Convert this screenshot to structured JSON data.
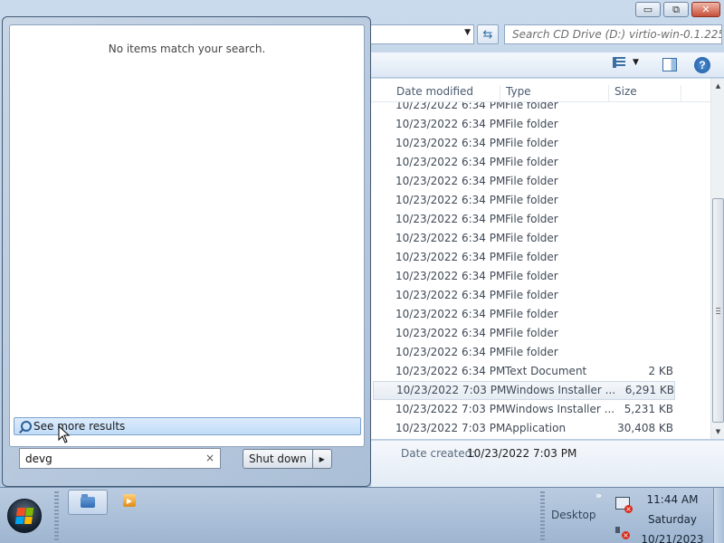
{
  "explorer": {
    "window_controls": {
      "minimize": "▭",
      "restore": "⧉",
      "close": "✕"
    },
    "address_dropdown": "▼",
    "refresh_glyph": "⇆",
    "search_placeholder": "Search CD Drive (D:) virtio-win-0.1.225",
    "toolbar": {
      "views_arrow": "▼",
      "help": "?"
    },
    "columns": {
      "date": "Date modified",
      "type": "Type",
      "size": "Size"
    },
    "rows": [
      {
        "date": "10/23/2022 6:34 PM",
        "type": "File folder",
        "size": ""
      },
      {
        "date": "10/23/2022 6:34 PM",
        "type": "File folder",
        "size": ""
      },
      {
        "date": "10/23/2022 6:34 PM",
        "type": "File folder",
        "size": ""
      },
      {
        "date": "10/23/2022 6:34 PM",
        "type": "File folder",
        "size": ""
      },
      {
        "date": "10/23/2022 6:34 PM",
        "type": "File folder",
        "size": ""
      },
      {
        "date": "10/23/2022 6:34 PM",
        "type": "File folder",
        "size": ""
      },
      {
        "date": "10/23/2022 6:34 PM",
        "type": "File folder",
        "size": ""
      },
      {
        "date": "10/23/2022 6:34 PM",
        "type": "File folder",
        "size": ""
      },
      {
        "date": "10/23/2022 6:34 PM",
        "type": "File folder",
        "size": ""
      },
      {
        "date": "10/23/2022 6:34 PM",
        "type": "File folder",
        "size": ""
      },
      {
        "date": "10/23/2022 6:34 PM",
        "type": "File folder",
        "size": ""
      },
      {
        "date": "10/23/2022 6:34 PM",
        "type": "File folder",
        "size": ""
      },
      {
        "date": "10/23/2022 6:34 PM",
        "type": "File folder",
        "size": ""
      },
      {
        "date": "10/23/2022 6:34 PM",
        "type": "File folder",
        "size": ""
      },
      {
        "date": "10/23/2022 6:34 PM",
        "type": "Text Document",
        "size": "2 KB"
      },
      {
        "date": "10/23/2022 7:03 PM",
        "type": "Windows Installer ...",
        "size": "6,291 KB",
        "selected": true
      },
      {
        "date": "10/23/2022 7:03 PM",
        "type": "Windows Installer ...",
        "size": "5,231 KB"
      },
      {
        "date": "10/23/2022 7:03 PM",
        "type": "Application",
        "size": "30,408 KB"
      }
    ],
    "scroll": {
      "up": "▲",
      "down": "▼"
    },
    "details": {
      "label": "Date created:",
      "value": "10/23/2022 7:03 PM"
    }
  },
  "start_menu": {
    "no_results": "No items match your search.",
    "see_more": "See more results",
    "search_value": "devg",
    "search_clear": "×",
    "shutdown_label": "Shut down",
    "shutdown_arrow": "▶"
  },
  "taskbar": {
    "media_glyph": "▶",
    "desktop_label": "Desktop",
    "show_hidden": "»",
    "clock": {
      "time": "11:44 AM",
      "day": "Saturday",
      "date": "10/21/2023"
    }
  },
  "colors": {
    "selection": "#c1dcf8",
    "accent": "#2d5f96",
    "error_badge": "#d72c1d"
  },
  "icons": {
    "start": "windows-orb-icon",
    "explorer": "folder-icon",
    "media": "media-player-icon",
    "network": "network-disconnected-icon",
    "volume": "volume-muted-icon",
    "search": "magnifier-icon",
    "help": "help-icon"
  }
}
